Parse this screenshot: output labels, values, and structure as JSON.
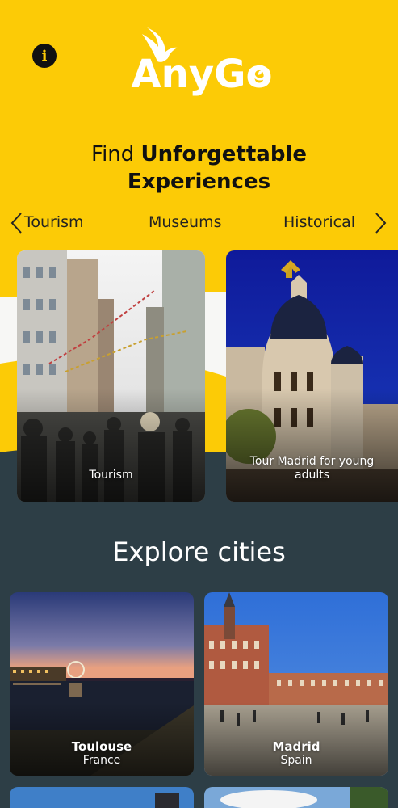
{
  "app": {
    "logo_text": "AnyGo"
  },
  "header": {
    "info_icon": "info-icon",
    "headline_regular": "Find ",
    "headline_bold_1": "Unforgettable",
    "headline_bold_2": "Experiences"
  },
  "categories": {
    "items": [
      "Tourism",
      "Museums",
      "Historical"
    ],
    "prev_icon": "chevron-left-icon",
    "next_icon": "chevron-right-icon"
  },
  "experiences": [
    {
      "label": "Tourism"
    },
    {
      "label_line1": "Tour Madrid for young",
      "label_line2": "adults"
    }
  ],
  "explore": {
    "title": "Explore cities",
    "cities": [
      {
        "name": "Toulouse",
        "country": "France"
      },
      {
        "name": "Madrid",
        "country": "Spain"
      }
    ]
  },
  "colors": {
    "accent": "#fccb06",
    "dark": "#2d3e46"
  }
}
